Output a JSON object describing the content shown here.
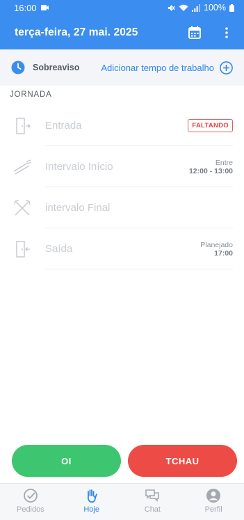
{
  "status_bar": {
    "time": "16:00",
    "battery": "100%"
  },
  "header": {
    "title": "terça-feira, 27 mai. 2025",
    "icons": [
      "calendar-icon",
      "more-vert-icon"
    ]
  },
  "standby": {
    "label": "Sobreaviso",
    "add_work_time": "Adicionar tempo de trabalho"
  },
  "journey": {
    "section_title": "JORNADA",
    "items": [
      {
        "label": "Entrada",
        "icon": "door-enter-icon",
        "badge": "FALTANDO"
      },
      {
        "label": "Intervalo Início",
        "icon": "cutlery-icon",
        "note": "Entre",
        "value": "12:00 - 13:00"
      },
      {
        "label": "intervalo Final",
        "icon": "cutlery-cross-icon"
      },
      {
        "label": "Saída",
        "icon": "door-exit-icon",
        "note": "Planejado",
        "value": "17:00"
      }
    ]
  },
  "actions": {
    "hello": "OI",
    "bye": "TCHAU"
  },
  "bottom_nav": {
    "items": [
      {
        "label": "Pedidos",
        "icon": "check-circle-icon"
      },
      {
        "label": "Hoje",
        "icon": "hand-icon",
        "active": true
      },
      {
        "label": "Chat",
        "icon": "chat-icon"
      },
      {
        "label": "Perfil",
        "icon": "person-icon"
      }
    ]
  },
  "colors": {
    "primary": "#3b8df0",
    "accent_link": "#2f86e6",
    "success": "#3ec56f",
    "danger": "#ec4c45"
  }
}
